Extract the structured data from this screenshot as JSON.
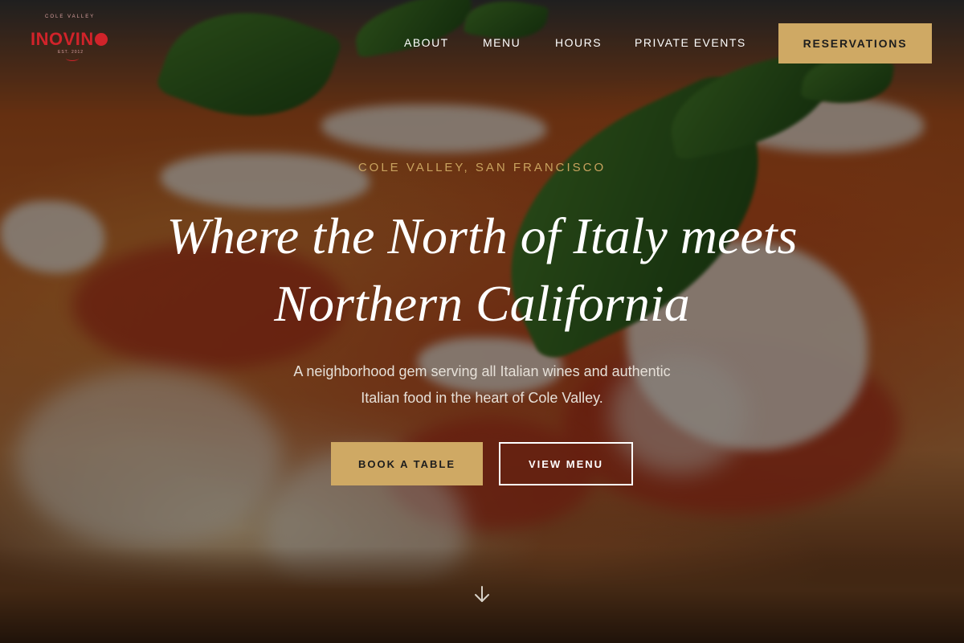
{
  "brand": {
    "name_main": "INOVIN",
    "tagline_top": "COLE VALLEY",
    "est": "EST. 2012",
    "accent_color": "#d1232a"
  },
  "nav": {
    "items": [
      {
        "label": "ABOUT"
      },
      {
        "label": "MENU"
      },
      {
        "label": "HOURS"
      },
      {
        "label": "PRIVATE EVENTS"
      }
    ],
    "cta_label": "RESERVATIONS",
    "cta_color": "#cfa964"
  },
  "hero": {
    "eyebrow": "COLE VALLEY, SAN FRANCISCO",
    "headline_line1": "Where the North of Italy meets",
    "headline_line2": "Northern California",
    "subtitle_line1": "A neighborhood gem serving all Italian wines and authentic",
    "subtitle_line2": "Italian food in the heart of Cole Valley.",
    "primary_button": "BOOK A TABLE",
    "secondary_button": "VIEW MENU",
    "scroll_icon": "arrow-down-icon"
  }
}
